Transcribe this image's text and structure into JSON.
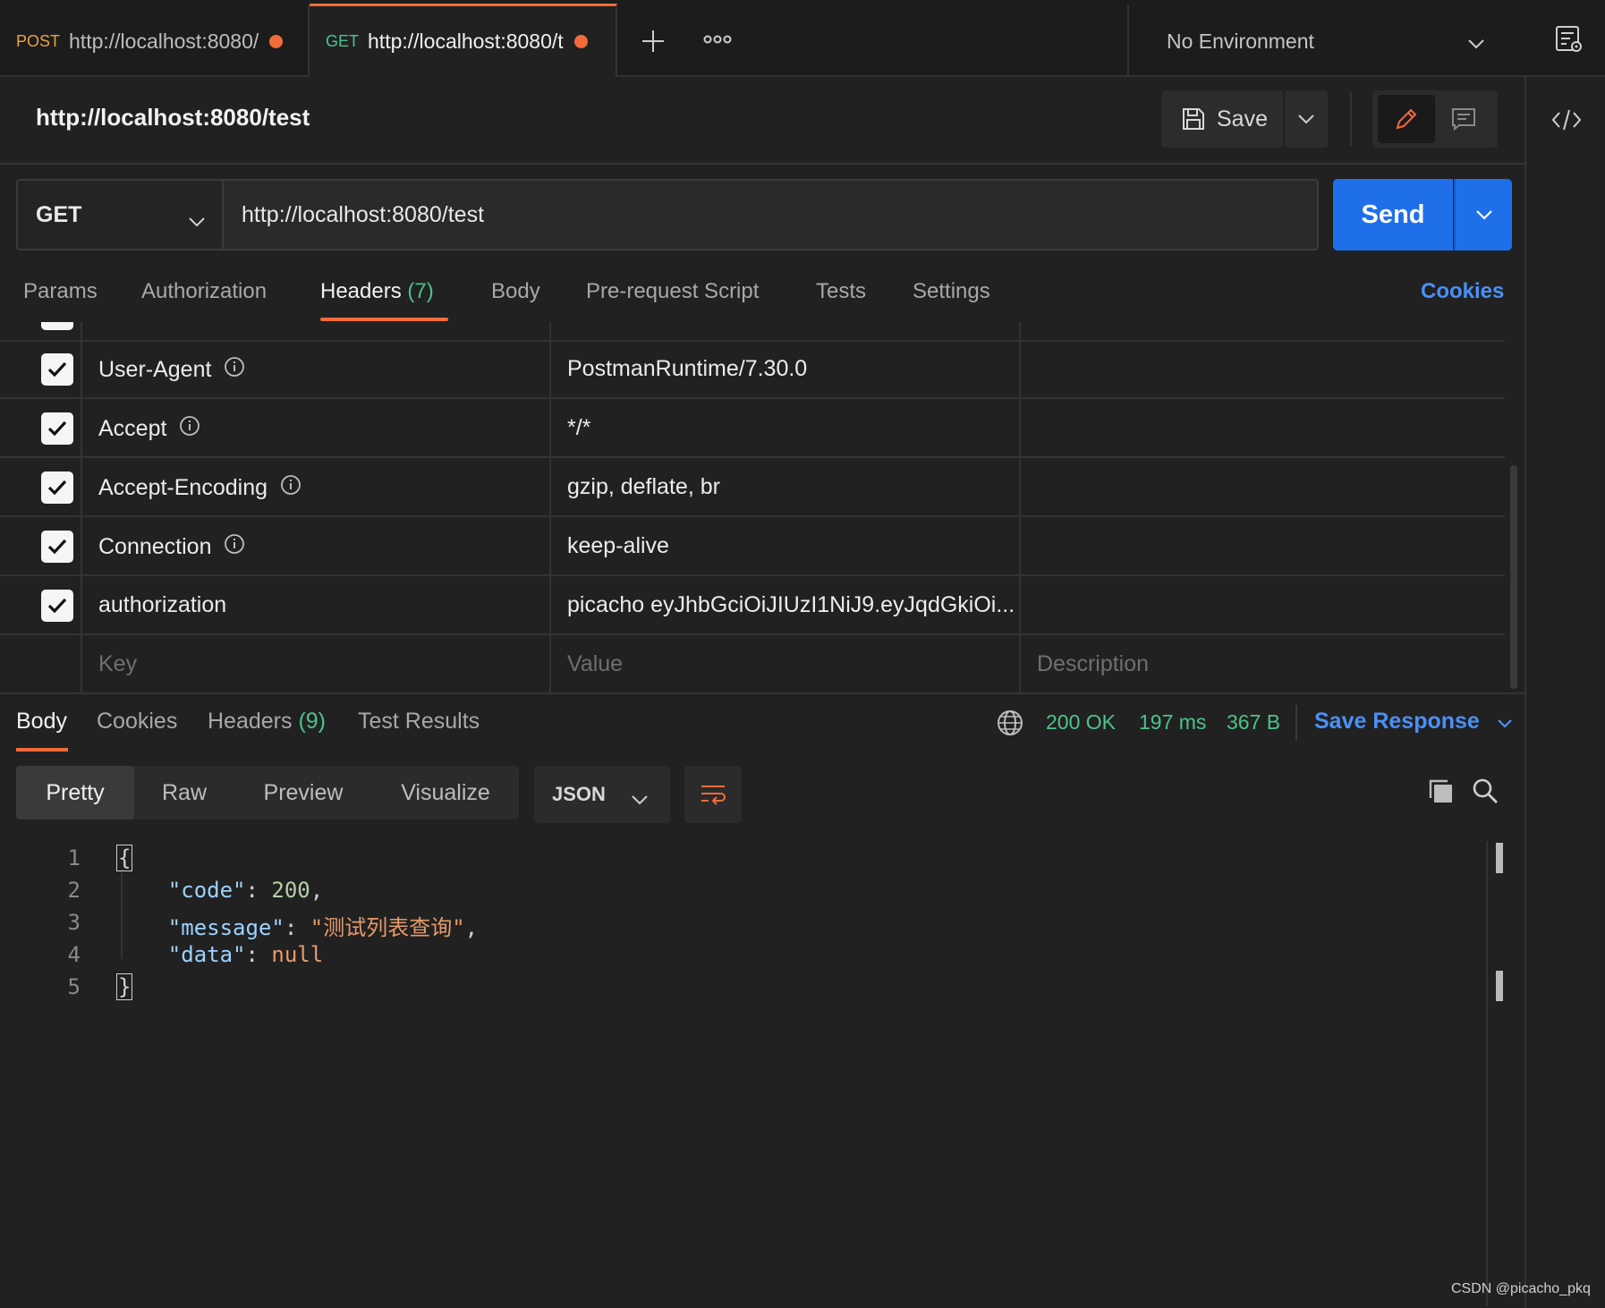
{
  "tabs": [
    {
      "method": "POST",
      "url": "http://localhost:8080/",
      "method_color": "#e8a33d"
    },
    {
      "method": "GET",
      "url": "http://localhost:8080/t",
      "method_color": "#4cc38a"
    }
  ],
  "environment": "No Environment",
  "request": {
    "title": "http://localhost:8080/test",
    "save_label": "Save",
    "method": "GET",
    "url": "http://localhost:8080/test",
    "send_label": "Send"
  },
  "request_tabs": {
    "params": "Params",
    "authorization": "Authorization",
    "headers": "Headers",
    "headers_count": "(7)",
    "body": "Body",
    "prerequest": "Pre-request Script",
    "tests": "Tests",
    "settings": "Settings",
    "cookies": "Cookies"
  },
  "headers": [
    {
      "key": "User-Agent",
      "value": "PostmanRuntime/7.30.0"
    },
    {
      "key": "Accept",
      "value": "*/*"
    },
    {
      "key": "Accept-Encoding",
      "value": "gzip, deflate, br"
    },
    {
      "key": "Connection",
      "value": "keep-alive"
    },
    {
      "key": "authorization",
      "value": "picacho eyJhbGciOiJIUzI1NiJ9.eyJqdGkiOi..."
    }
  ],
  "headers_placeholder": {
    "key": "Key",
    "value": "Value",
    "description": "Description"
  },
  "response_tabs": {
    "body": "Body",
    "cookies": "Cookies",
    "headers": "Headers",
    "headers_count": "(9)",
    "test_results": "Test Results"
  },
  "response_status": {
    "status": "200 OK",
    "time": "197 ms",
    "size": "367 B",
    "save_response": "Save Response"
  },
  "format_tabs": [
    "Pretty",
    "Raw",
    "Preview",
    "Visualize"
  ],
  "format_language": "JSON",
  "code_lines": {
    "numbers": [
      "1",
      "2",
      "3",
      "4",
      "5"
    ],
    "open_brace": "{",
    "close_brace": "}",
    "code_key": "\"code\"",
    "code_value": "200",
    "message_key": "\"message\"",
    "message_value": "\"测试列表查询\"",
    "data_key": "\"data\"",
    "data_value": "null"
  },
  "watermark": "CSDN @picacho_pkq",
  "colors": {
    "accent": "#f26b3a",
    "send": "#1f6feb",
    "success": "#4cc38a",
    "link": "#4a90f7"
  }
}
